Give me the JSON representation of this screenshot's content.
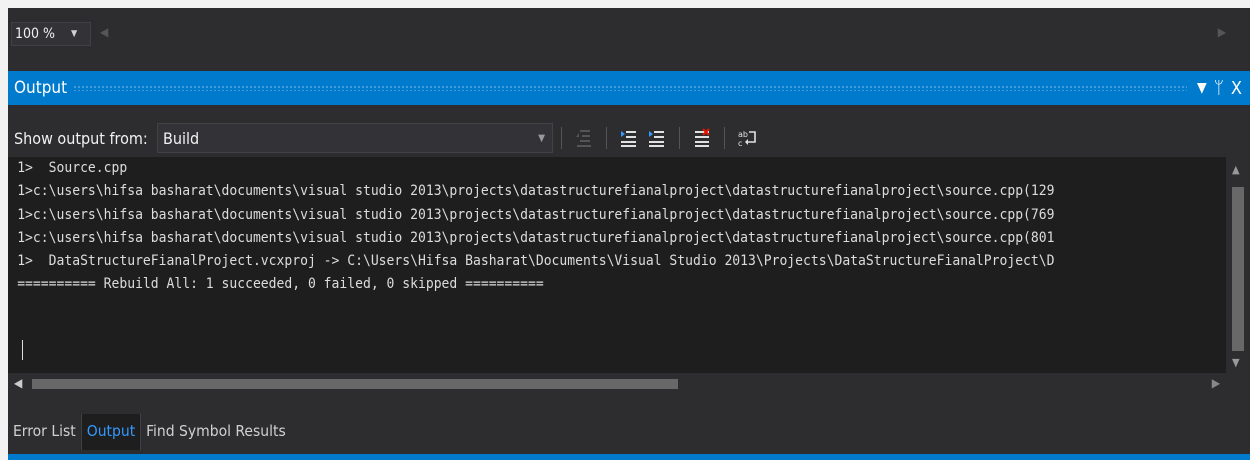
{
  "zoom": {
    "value": "100 %"
  },
  "panel": {
    "title": "Output"
  },
  "toolbar": {
    "show_output_label": "Show output from:",
    "source_selected": "Build"
  },
  "output": {
    "lines": [
      "1>  Source.cpp",
      "1>c:\\users\\hifsa basharat\\documents\\visual studio 2013\\projects\\datastructurefianalproject\\datastructurefianalproject\\source.cpp(129",
      "1>c:\\users\\hifsa basharat\\documents\\visual studio 2013\\projects\\datastructurefianalproject\\datastructurefianalproject\\source.cpp(769",
      "1>c:\\users\\hifsa basharat\\documents\\visual studio 2013\\projects\\datastructurefianalproject\\datastructurefianalproject\\source.cpp(801",
      "1>  DataStructureFianalProject.vcxproj -> C:\\Users\\Hifsa Basharat\\Documents\\Visual Studio 2013\\Projects\\DataStructureFianalProject\\D",
      "========== Rebuild All: 1 succeeded, 0 failed, 0 skipped =========="
    ]
  },
  "tabs": [
    "Error List",
    "Output",
    "Find Symbol Results"
  ],
  "colors": {
    "accent": "#007acc",
    "background": "#2d2d30",
    "editor": "#1e1e1e",
    "active_tab": "#3399ff"
  },
  "icons": [
    "go-to-previous-message-icon",
    "go-to-next-message-icon",
    "find-message-in-code-icon",
    "clear-all-icon",
    "toggle-word-wrap-icon"
  ]
}
